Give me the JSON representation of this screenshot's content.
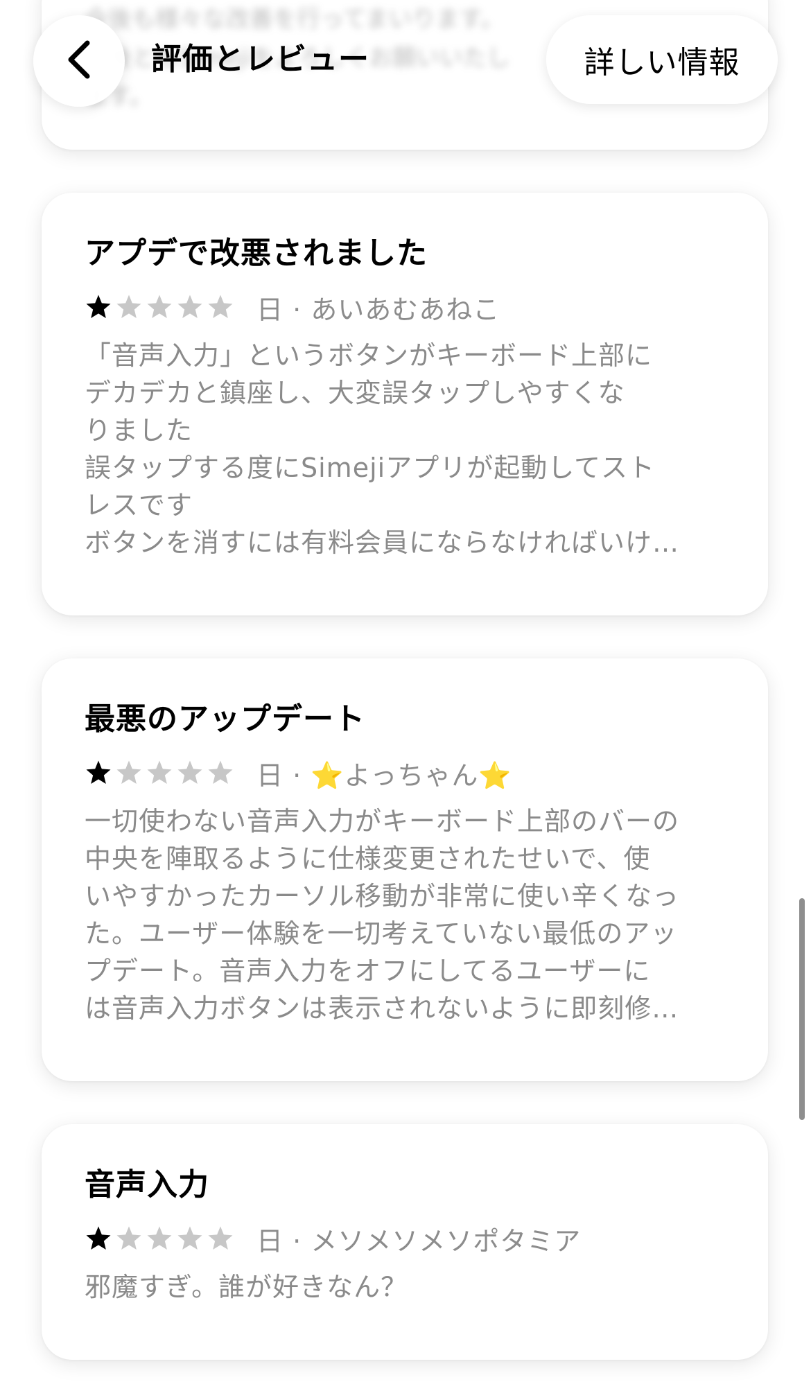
{
  "nav": {
    "title": "評価とレビュー",
    "more_label": "詳しい情報"
  },
  "top_card": {
    "lines": [
      "今後も様々な改善を行ってまいります。",
      "今後ともSimejiをよろしくお願いいたし",
      "ます。"
    ]
  },
  "reviews": [
    {
      "title": "アプデで改悪されました",
      "rating": 1,
      "meta": "日 · あいあむあねこ",
      "body_lines": [
        "「音声入力」というボタンがキーボード上部に",
        "デカデカと鎮座し、大変誤タップしやすくな",
        "りました",
        "誤タップする度にSimejiアプリが起動してスト",
        "レスです",
        "ボタンを消すには有料会員にならなければいけ…"
      ]
    },
    {
      "title": "最悪のアップデート",
      "rating": 1,
      "meta": "日 · ⭐よっちゃん⭐",
      "body_lines": [
        "一切使わない音声入力がキーボード上部のバーの",
        "中央を陣取るように仕様変更されたせいで、使",
        "いやすかったカーソル移動が非常に使い辛くなっ",
        "た。ユーザー体験を一切考えていない最低のアッ",
        "プデート。音声入力をオフにしてるユーザーに",
        "は音声入力ボタンは表示されないように即刻修…"
      ]
    },
    {
      "title": "音声入力",
      "rating": 1,
      "meta": "日 · メソメソメソポタミア",
      "body_lines": [
        "邪魔すぎ。誰が好きなん？"
      ]
    }
  ],
  "colors": {
    "star_filled": "#000000",
    "star_empty": "#c7c7c7",
    "secondary_text": "#8a8a8a"
  }
}
